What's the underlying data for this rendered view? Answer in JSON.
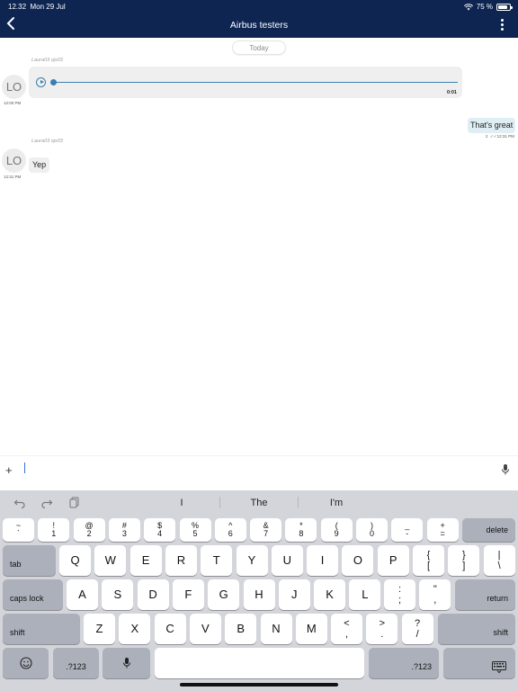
{
  "status": {
    "time": "12.32",
    "date": "Mon 29 Jul",
    "battery": "75 %",
    "battery_level": 0.75
  },
  "nav": {
    "title": "Airbus testers"
  },
  "messages": {
    "date_divider": "Today",
    "m1": {
      "sender": "Laura03 ojs03",
      "avatar": "LO",
      "time": "12:00 PM",
      "type": "audio",
      "duration": "0:01",
      "progress": 0
    },
    "m2": {
      "text": "That's great",
      "count": "2",
      "time": "12:31 PM",
      "checkmarks": "✓✓"
    },
    "m3": {
      "sender": "Laura03 ojs03",
      "avatar": "LO",
      "time": "12:31 PM",
      "text": "Yep"
    }
  },
  "composer": {
    "value": "",
    "placeholder": ""
  },
  "keyboard": {
    "predictions": [
      "I",
      "The",
      "I'm"
    ],
    "number_row": [
      {
        "top": "~",
        "bot": "`"
      },
      {
        "top": "!",
        "bot": "1"
      },
      {
        "top": "@",
        "bot": "2"
      },
      {
        "top": "#",
        "bot": "3"
      },
      {
        "top": "$",
        "bot": "4"
      },
      {
        "top": "%",
        "bot": "5"
      },
      {
        "top": "^",
        "bot": "6"
      },
      {
        "top": "&",
        "bot": "7"
      },
      {
        "top": "*",
        "bot": "8"
      },
      {
        "top": "(",
        "bot": "9"
      },
      {
        "top": ")",
        "bot": "0"
      },
      {
        "top": "_",
        "bot": "-"
      },
      {
        "top": "+",
        "bot": "="
      }
    ],
    "delete": "delete",
    "tab": "tab",
    "row_q": [
      "Q",
      "W",
      "E",
      "R",
      "T",
      "Y",
      "U",
      "I",
      "O",
      "P"
    ],
    "row_q_extra": [
      {
        "top": "{",
        "bot": "["
      },
      {
        "top": "}",
        "bot": "]"
      },
      {
        "top": "|",
        "bot": "\\"
      }
    ],
    "caps": "caps lock",
    "row_a": [
      "A",
      "S",
      "D",
      "F",
      "G",
      "H",
      "J",
      "K",
      "L"
    ],
    "row_a_extra": [
      {
        "top": ":",
        "bot": ";"
      },
      {
        "top": "\"",
        "bot": ","
      }
    ],
    "return": "return",
    "shift": "shift",
    "row_z": [
      "Z",
      "X",
      "C",
      "V",
      "B",
      "N",
      "M"
    ],
    "row_z_extra": [
      {
        "top": "<",
        "bot": ","
      },
      {
        "top": ">",
        "bot": "."
      },
      {
        "top": "?",
        "bot": "/"
      }
    ],
    "num_label": ".?123"
  },
  "colors": {
    "navbar": "#0e2552",
    "accent": "#3a7fb0",
    "outgoing_bubble": "#dfeef3",
    "incoming_bubble": "#efefef",
    "keyboard_bg": "#d3d5db"
  }
}
